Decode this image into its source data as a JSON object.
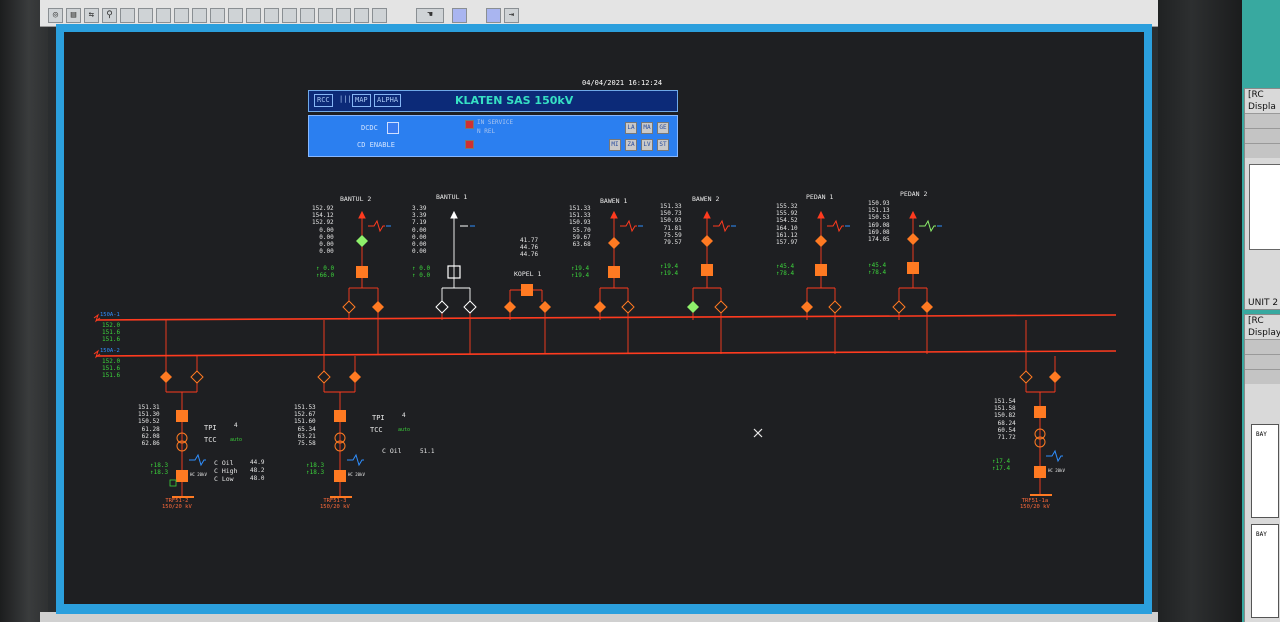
{
  "diagram": {
    "timestamp": "04/04/2021 16:12:24",
    "header": {
      "buttons": [
        "RCC",
        "|||",
        "MAP",
        "ALPHA"
      ],
      "title": "KLATEN SAS 150kV"
    },
    "controls": {
      "label_1": "DCDC",
      "label_2": "CD ENABLE",
      "status_1": "IN SERVICE",
      "status_2": "N REL",
      "buttons_row1": [
        "LA",
        "MA",
        "GE"
      ],
      "buttons_row2": [
        "MI",
        "ZA",
        "LV",
        "ST"
      ]
    },
    "bays": [
      {
        "name": "BANTUL 2",
        "values": "152.92\n154.12\n152.92\n0.00\n0.00\n0.00\n0.00",
        "green": "↑ 0.0\n↑66.0"
      },
      {
        "name": "BANTUL 1",
        "values": "3.39\n3.39\n7.19\n0.00\n0.00\n0.00\n0.00",
        "green": "↑ 0.0\n↑ 0.0"
      },
      {
        "name": "KOPEL 1",
        "values": "41.77\n44.76\n44.76",
        "green": ""
      },
      {
        "name": "BAWEN 1",
        "values": "151.33\n151.33\n150.93\n55.70\n59.67\n63.68",
        "green": "↑19.4\n↑19.4"
      },
      {
        "name": "BAWEN 2",
        "values": "151.33\n150.73\n150.93\n71.81\n75.59\n79.57",
        "green": "↑19.4\n↑19.4"
      },
      {
        "name": "PEDAN 1",
        "values": "155.32\n155.92\n154.52\n164.10\n161.12\n157.97",
        "green": "↑45.4\n↑78.4"
      },
      {
        "name": "PEDAN 2",
        "values": "150.93\n151.13\n150.53\n169.08\n169.08\n174.05",
        "green": "↑45.4\n↑78.4"
      }
    ],
    "busbars": [
      {
        "label": "150A-1",
        "values": "152.0\n151.6\n151.6"
      },
      {
        "label": "150A-2",
        "values": "152.0\n151.6\n151.6"
      }
    ],
    "transformers": [
      {
        "values": "151.31\n151.30\n150.52\n61.28\n62.08\n62.86",
        "green": "↑18.3\n↑18.3",
        "tpi_label": "TPI",
        "tpi_value": "4",
        "tcc_label": "TCC",
        "tcc_value": "auto",
        "coil_labels": "C Oil\nC High\nC Low",
        "coil_values": "44.9\n48.2\n48.0",
        "hv_tag": "HC 20kV",
        "name": "TRF51-2\n150/20 kV"
      },
      {
        "values": "151.53\n152.67\n151.60\n65.34\n63.21\n75.58",
        "green": "↑18.3\n↑18.3",
        "tpi_label": "TPI",
        "tpi_value": "4",
        "tcc_label": "TCC",
        "tcc_value": "auto",
        "coil_labels": "C Oil",
        "coil_values": "51.1",
        "hv_tag": "HC 20kV",
        "name": "TRF51-3\n150/20 kV"
      },
      {
        "values": "151.54\n151.58\n150.82\n68.24\n60.54\n71.72",
        "green": "↑17.4\n↑17.4",
        "hv_tag": "HC 20kV",
        "name": "TRF51-1a\n150/20 kV"
      }
    ]
  },
  "colors": {
    "bus": "#ff3b1f",
    "breaker": "#ff7a22",
    "iso_green": "#8ef06b",
    "flow_blue": "#2f8fff",
    "panel": "#2b7ff0",
    "screen_frame": "#2b9fdd"
  },
  "right_panel": {
    "title_1": "[RC",
    "sub_1": "Displa",
    "unit": "UNIT 2",
    "title_2": "[RC",
    "sub_2": "Display",
    "bay_1": "BAY",
    "bay_2": "BAY"
  },
  "icons": [
    "globe-icon",
    "print-icon",
    "zoom-icon",
    "close-x-icon"
  ]
}
